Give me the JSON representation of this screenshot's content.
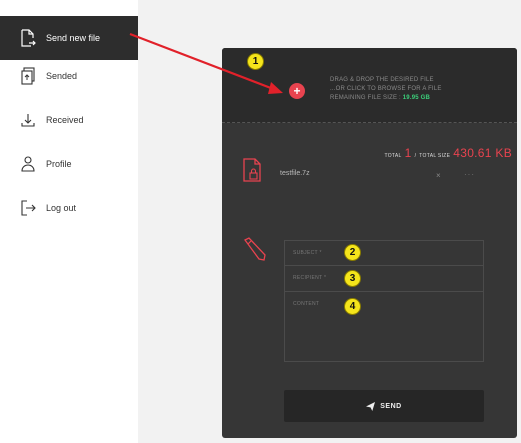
{
  "sidebar": {
    "items": [
      {
        "label": "Send new file",
        "icon": "file-send-icon",
        "active": true
      },
      {
        "label": "Sended",
        "icon": "sent-files-icon",
        "active": false
      },
      {
        "label": "Received",
        "icon": "download-icon",
        "active": false
      },
      {
        "label": "Profile",
        "icon": "user-icon",
        "active": false
      },
      {
        "label": "Log out",
        "icon": "logout-icon",
        "active": false
      }
    ]
  },
  "upload": {
    "drop_line1": "DRAG & DROP THE DESIRED FILE",
    "drop_line2": "...OR CLICK TO BROWSE FOR A FILE",
    "remaining_label": "REMAINING FILE SIZE :",
    "remaining_value": "19.95 GB",
    "plus": "+"
  },
  "totals": {
    "total_label": "TOTAL",
    "total_count": "1",
    "separator": "/",
    "size_label": "TOTAL SIZE",
    "size_value": "430.61 KB"
  },
  "files": [
    {
      "name": "testfile.7z",
      "remove": "×",
      "more": "···"
    }
  ],
  "form": {
    "subject_placeholder": "SUBJECT *",
    "recipient_placeholder": "RECIPIENT *",
    "content_placeholder": "CONTENT",
    "send_label": "SEND"
  },
  "annotations": [
    "1",
    "2",
    "3",
    "4"
  ],
  "colors": {
    "accent": "#e8434f",
    "success": "#3bd07a",
    "badge": "#f5e51b",
    "card": "#363636",
    "sidebar_active": "#2d2d2d"
  }
}
